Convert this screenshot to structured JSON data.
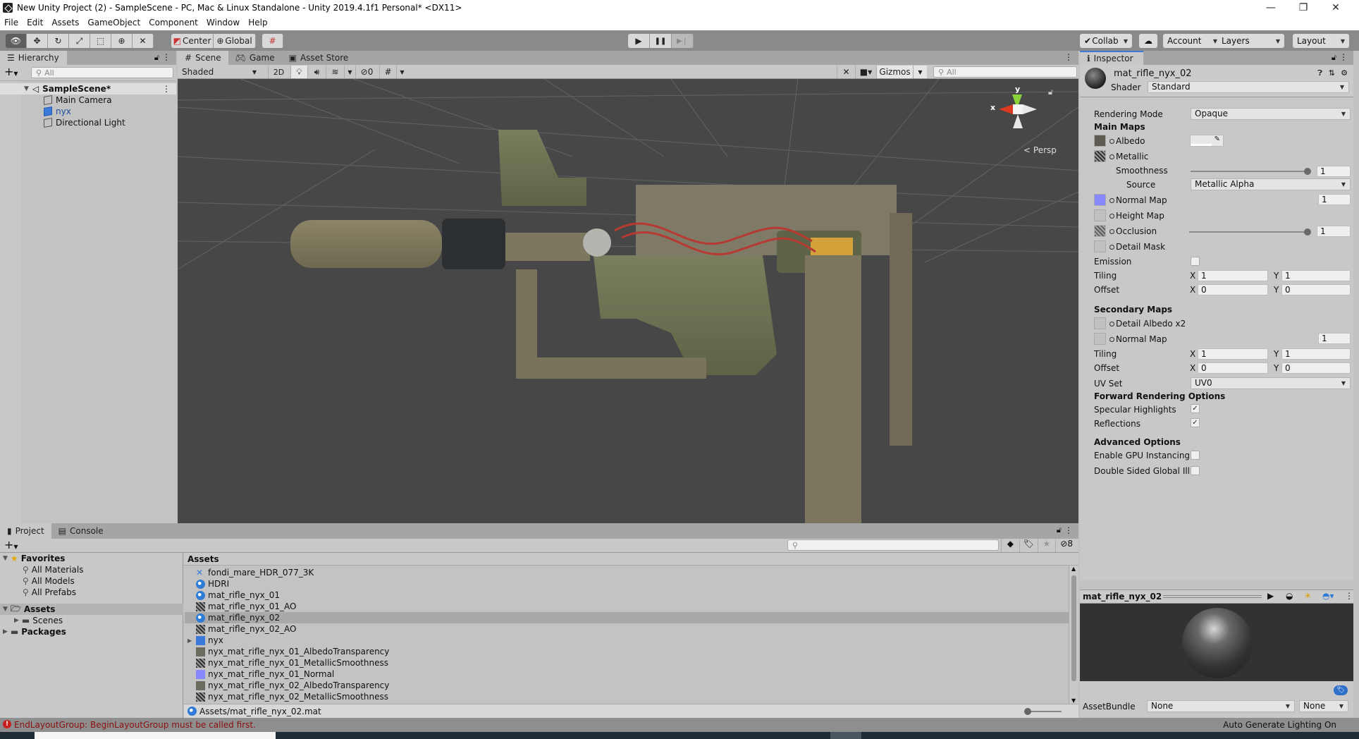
{
  "window": {
    "title": "New Unity Project (2) - SampleScene - PC, Mac & Linux Standalone - Unity 2019.4.1f1 Personal* <DX11>",
    "minimize": "—",
    "maximize": "❐",
    "close": "✕"
  },
  "menu": [
    "File",
    "Edit",
    "Assets",
    "GameObject",
    "Component",
    "Window",
    "Help"
  ],
  "toolbar": {
    "tools": [
      "view",
      "move",
      "rotate",
      "scale",
      "rect",
      "transform",
      "custom"
    ],
    "pivot": "Center",
    "space": "Global",
    "play": "▶",
    "pause": "❚❚",
    "step": "▶❘",
    "collab": "Collab",
    "account": "Account",
    "layers": "Layers",
    "layout": "Layout"
  },
  "hierarchy": {
    "tab": "Hierarchy",
    "search_placeholder": "All",
    "scene": "SampleScene*",
    "items": [
      {
        "label": "Main Camera",
        "selected": false
      },
      {
        "label": "nyx",
        "selected": false,
        "prefab": true
      },
      {
        "label": "Directional Light",
        "selected": false
      }
    ]
  },
  "scene_tabs": [
    "Scene",
    "Game",
    "Asset Store"
  ],
  "scene_toolbar": {
    "shading": "Shaded",
    "mode_2d": "2D",
    "hidden_count": "0",
    "gizmos": "Gizmos",
    "search_placeholder": "All"
  },
  "viewport": {
    "projection": "Persp",
    "axis_x": "x",
    "axis_y": "y"
  },
  "inspector": {
    "tab": "Inspector",
    "material_name": "mat_rifle_nyx_02",
    "shader_label": "Shader",
    "shader_value": "Standard",
    "rendering_mode_label": "Rendering Mode",
    "rendering_mode_value": "Opaque",
    "main_maps": "Main Maps",
    "albedo": "Albedo",
    "metallic": "Metallic",
    "smoothness_label": "Smoothness",
    "smoothness_value": "1",
    "source_label": "Source",
    "source_value": "Metallic Alpha",
    "normal_map": "Normal Map",
    "normal_value": "1",
    "height_map": "Height Map",
    "occlusion": "Occlusion",
    "occlusion_value": "1",
    "detail_mask": "Detail Mask",
    "emission": "Emission",
    "tiling": "Tiling",
    "offset": "Offset",
    "x": "X",
    "y": "Y",
    "main_tiling_x": "1",
    "main_tiling_y": "1",
    "main_offset_x": "0",
    "main_offset_y": "0",
    "secondary_maps": "Secondary Maps",
    "detail_albedo": "Detail Albedo x2",
    "sec_normal_map": "Normal Map",
    "sec_normal_value": "1",
    "sec_tiling_x": "1",
    "sec_tiling_y": "1",
    "sec_offset_x": "0",
    "sec_offset_y": "0",
    "uv_set_label": "UV Set",
    "uv_set_value": "UV0",
    "forward_rendering": "Forward Rendering Options",
    "specular_highlights": "Specular Highlights",
    "reflections": "Reflections",
    "advanced_options": "Advanced Options",
    "gpu_instancing": "Enable GPU Instancing",
    "double_sided": "Double Sided Global Illu",
    "checkmark": "✓",
    "preview_title": "mat_rifle_nyx_02",
    "assetbundle_label": "AssetBundle",
    "assetbundle_value": "None",
    "assetbundle_variant": "None"
  },
  "project": {
    "tabs": [
      "Project",
      "Console"
    ],
    "hidden_count": "8",
    "favorites": "Favorites",
    "favorite_items": [
      "All Materials",
      "All Models",
      "All Prefabs"
    ],
    "assets_root": "Assets",
    "asset_folders": [
      "Scenes"
    ],
    "packages": "Packages",
    "assets_header": "Assets",
    "assets": [
      {
        "name": "fondi_mare_HDR_077_3K",
        "icon": "hdr-texture"
      },
      {
        "name": "HDRI",
        "icon": "material"
      },
      {
        "name": "mat_rifle_nyx_01",
        "icon": "material"
      },
      {
        "name": "mat_rifle_nyx_01_AO",
        "icon": "texture"
      },
      {
        "name": "mat_rifle_nyx_02",
        "icon": "material",
        "selected": true
      },
      {
        "name": "mat_rifle_nyx_02_AO",
        "icon": "texture"
      },
      {
        "name": "nyx",
        "icon": "prefab"
      },
      {
        "name": "nyx_mat_rifle_nyx_01_AlbedoTransparency",
        "icon": "albedo"
      },
      {
        "name": "nyx_mat_rifle_nyx_01_MetallicSmoothness",
        "icon": "texture"
      },
      {
        "name": "nyx_mat_rifle_nyx_01_Normal",
        "icon": "normal"
      },
      {
        "name": "nyx_mat_rifle_nyx_02_AlbedoTransparency",
        "icon": "albedo"
      },
      {
        "name": "nyx_mat_rifle_nyx_02_MetallicSmoothness",
        "icon": "texture"
      }
    ],
    "selected_path": "Assets/mat_rifle_nyx_02.mat"
  },
  "status": {
    "error": "EndLayoutGroup: BeginLayoutGroup must be called first.",
    "lighting": "Auto Generate Lighting On"
  },
  "colors": {
    "error_red": "#b01818",
    "selection_blue": "#3b7ad8",
    "normal_map": "#8888ff"
  }
}
